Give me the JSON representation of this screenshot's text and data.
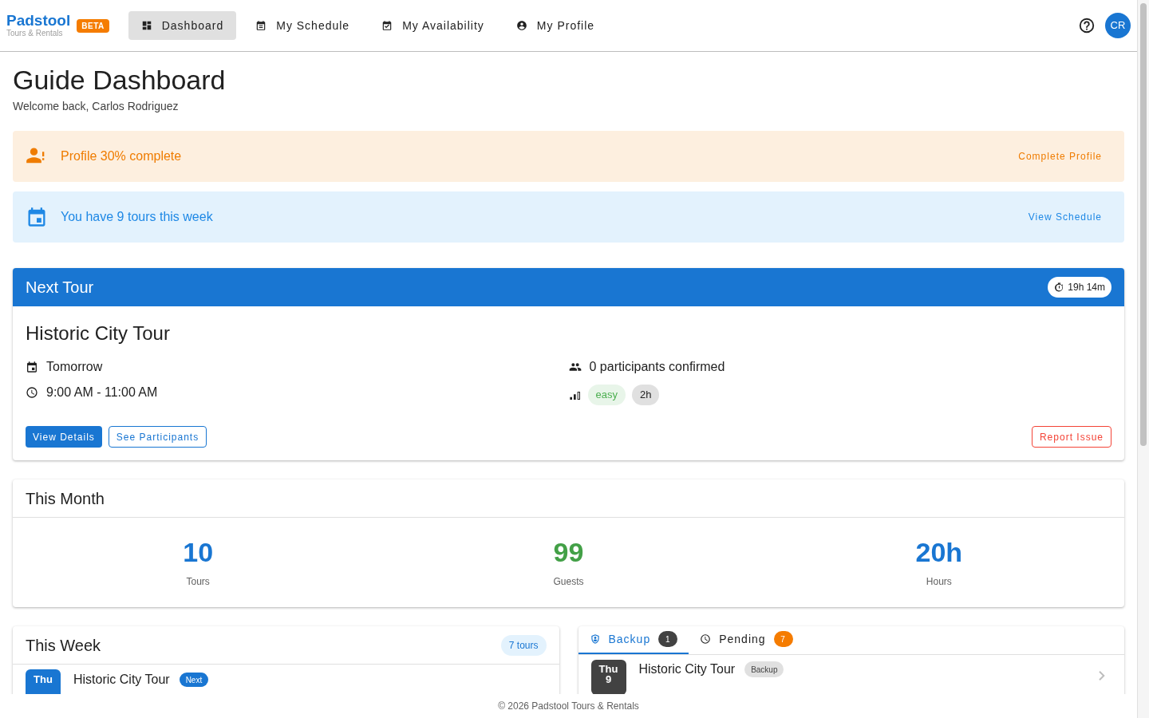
{
  "brand": {
    "name": "Padstool",
    "badge": "BETA",
    "tagline": "Tours & Rentals"
  },
  "nav": [
    {
      "label": "Dashboard",
      "selected": true
    },
    {
      "label": "My Schedule",
      "selected": false
    },
    {
      "label": "My Availability",
      "selected": false
    },
    {
      "label": "My Profile",
      "selected": false
    }
  ],
  "user": {
    "initials": "CR"
  },
  "page": {
    "title": "Guide Dashboard",
    "subtitle": "Welcome back, Carlos Rodriguez"
  },
  "alerts": [
    {
      "kind": "warning",
      "text": "Profile 30% complete",
      "action": "Complete Profile"
    },
    {
      "kind": "info",
      "text": "You have 9 tours this week",
      "action": "View Schedule"
    }
  ],
  "next_tour": {
    "heading": "Next Tour",
    "countdown": "19h 14m",
    "title": "Historic City Tour",
    "date": "Tomorrow",
    "time": "9:00 AM - 11:00 AM",
    "participants": "0 participants confirmed",
    "difficulty": "easy",
    "duration": "2h",
    "buttons": [
      "View Details",
      "See Participants"
    ],
    "report": "Report Issue"
  },
  "this_month": {
    "title": "This Month",
    "stats": [
      {
        "value": "10",
        "label": "Tours",
        "color": "#1976d2"
      },
      {
        "value": "99",
        "label": "Guests",
        "color": "#43a047"
      },
      {
        "value": "20h",
        "label": "Hours",
        "color": "#1976d2"
      }
    ]
  },
  "this_week": {
    "title": "This Week",
    "count": "7 tours",
    "rows": [
      {
        "day": "Thu",
        "title": "Historic City Tour",
        "tag": "Next"
      }
    ]
  },
  "requests": {
    "tabs": [
      {
        "label": "Backup",
        "count": "1",
        "selected": true
      },
      {
        "label": "Pending",
        "count": "7",
        "selected": false
      }
    ],
    "rows": [
      {
        "day": "Thu",
        "date": "9",
        "title": "Historic City Tour",
        "tag": "Backup"
      }
    ]
  },
  "footer": "© 2026 Padstool Tours & Rentals"
}
